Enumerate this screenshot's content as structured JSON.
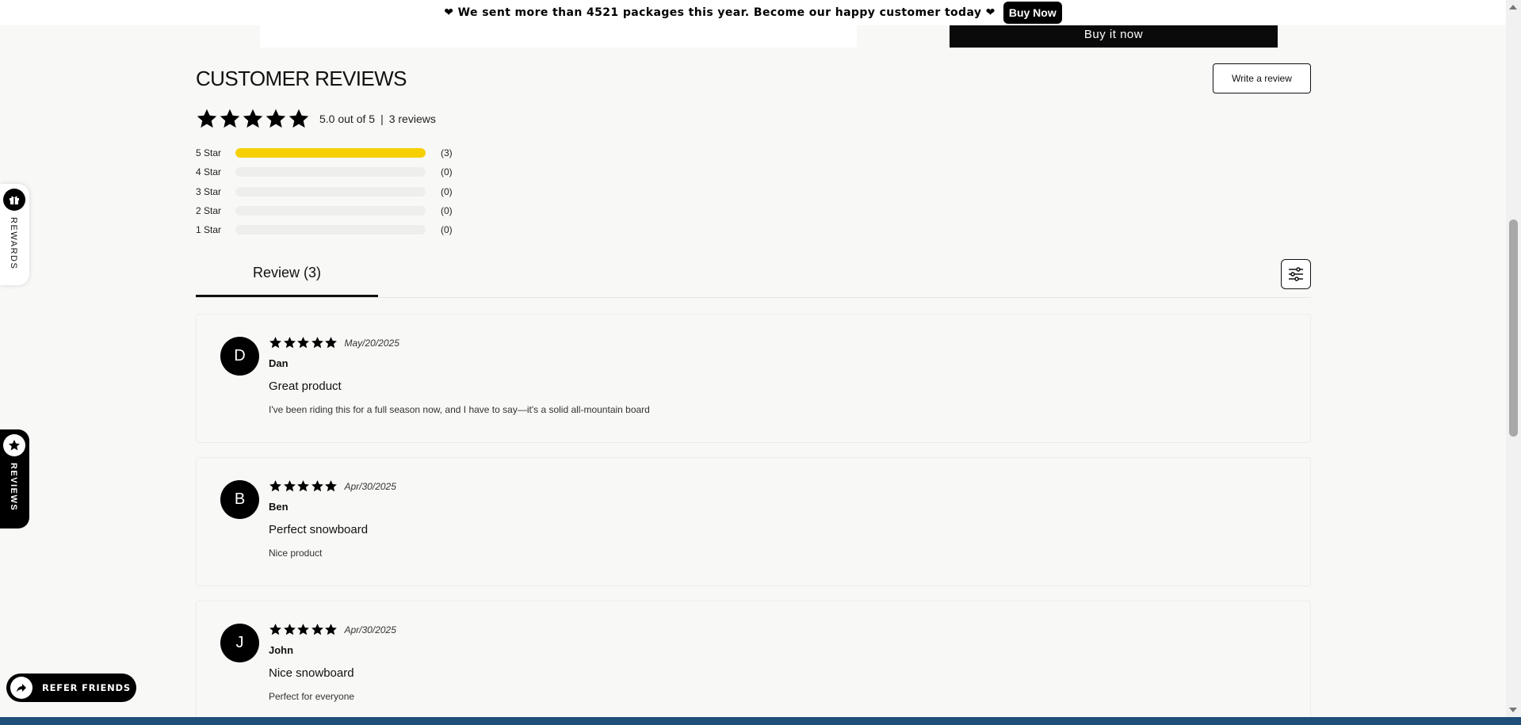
{
  "announcement": {
    "text": "❤ We sent more than 4521 packages this year. Become our happy customer today ❤",
    "button": "Buy Now"
  },
  "product": {
    "buy_it_now": "Buy it now"
  },
  "reviews_section": {
    "title": "CUSTOMER REVIEWS",
    "write_review": "Write a review",
    "rating_text": "5.0 out of 5",
    "separator": "|",
    "count_text": "3 reviews",
    "distribution": [
      {
        "label": "5 Star",
        "count": "(3)",
        "fraction": 1.0
      },
      {
        "label": "4 Star",
        "count": "(0)",
        "fraction": 0
      },
      {
        "label": "3 Star",
        "count": "(0)",
        "fraction": 0
      },
      {
        "label": "2 Star",
        "count": "(0)",
        "fraction": 0
      },
      {
        "label": "1 Star",
        "count": "(0)",
        "fraction": 0
      }
    ],
    "tab_label": "Review (3)",
    "items": [
      {
        "initial": "D",
        "rating": 5,
        "date": "May/20/2025",
        "name": "Dan",
        "title": "Great product",
        "body": "I've been riding this for a full season now, and I have to say—it's a solid all-mountain board"
      },
      {
        "initial": "B",
        "rating": 5,
        "date": "Apr/30/2025",
        "name": "Ben",
        "title": "Perfect snowboard",
        "body": "Nice product"
      },
      {
        "initial": "J",
        "rating": 5,
        "date": "Apr/30/2025",
        "name": "John",
        "title": "Nice snowboard",
        "body": "Perfect for everyone"
      }
    ]
  },
  "widgets": {
    "rewards": "REWARDS",
    "reviews": "REVIEWS",
    "refer": "REFER FRIENDS"
  },
  "colors": {
    "star": "#000000",
    "bar_fill": "#f6d000",
    "bar_empty": "#eeeeec"
  }
}
